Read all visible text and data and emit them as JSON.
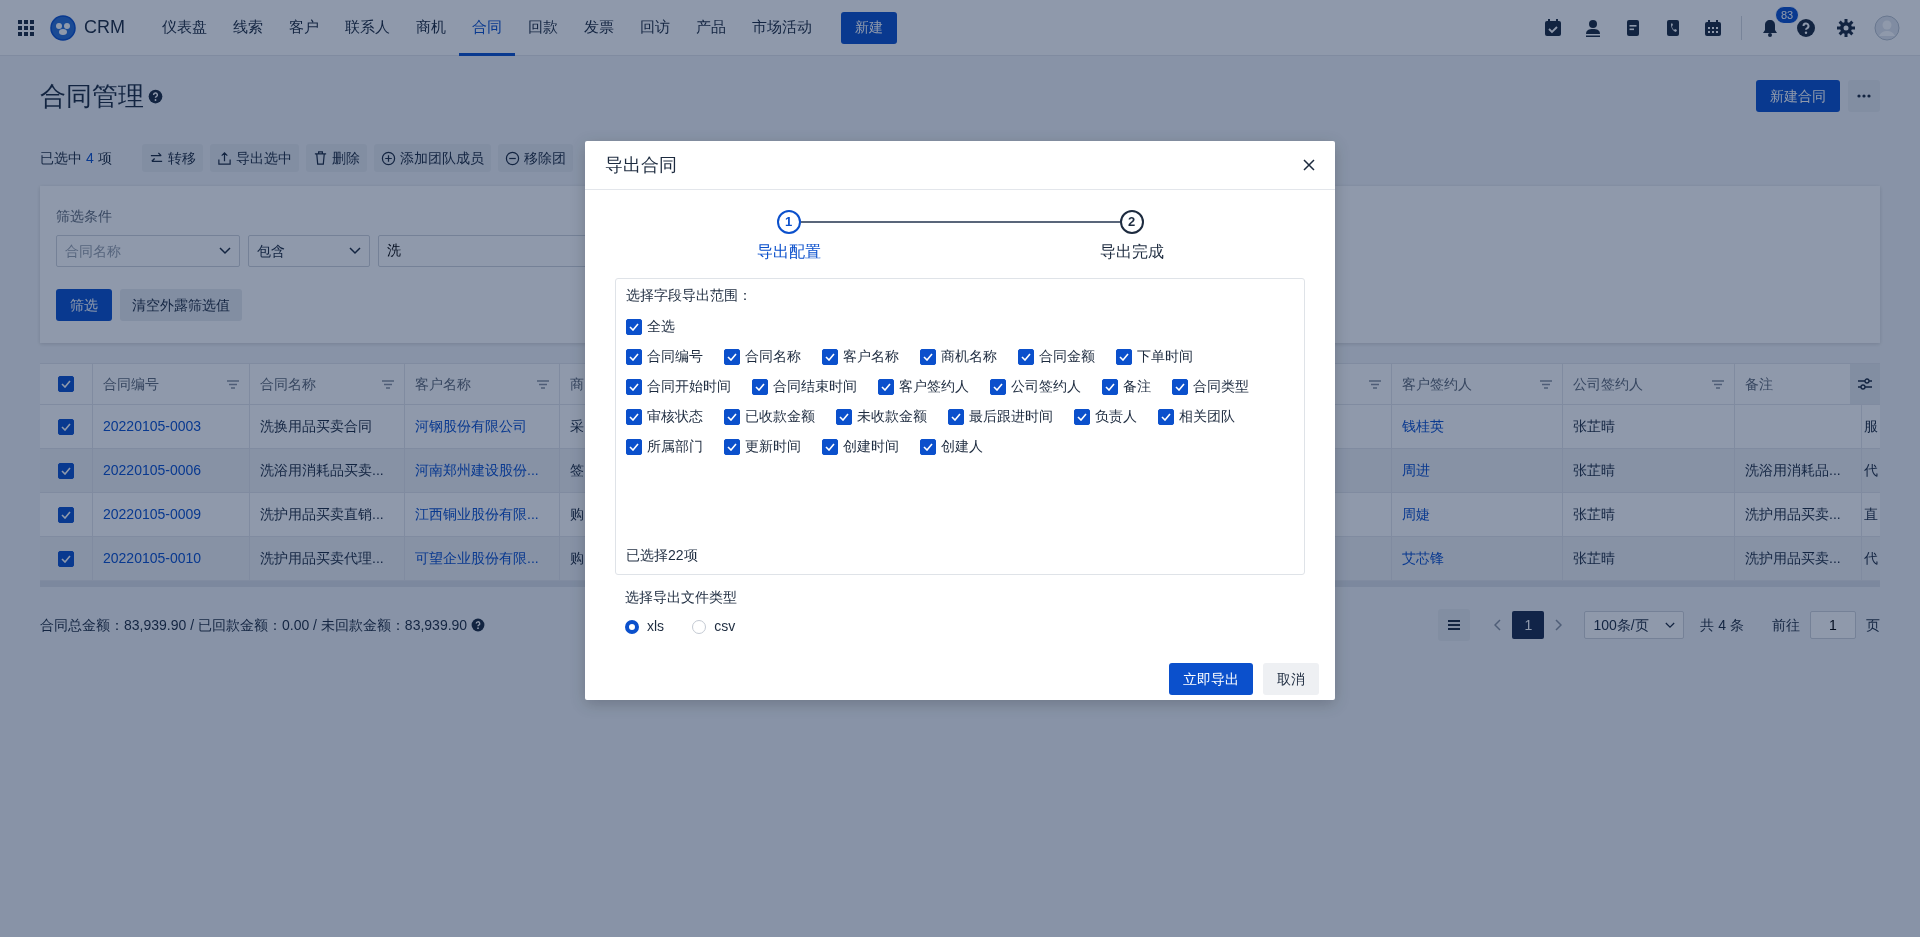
{
  "nav": {
    "brand": "CRM",
    "items": [
      {
        "label": "仪表盘",
        "selected": false
      },
      {
        "label": "线索",
        "selected": false
      },
      {
        "label": "客户",
        "selected": false
      },
      {
        "label": "联系人",
        "selected": false
      },
      {
        "label": "商机",
        "selected": false
      },
      {
        "label": "合同",
        "selected": true
      },
      {
        "label": "回款",
        "selected": false
      },
      {
        "label": "发票",
        "selected": false
      },
      {
        "label": "回访",
        "selected": false
      },
      {
        "label": "产品",
        "selected": false
      },
      {
        "label": "市场活动",
        "selected": false
      }
    ],
    "new_button": "新建",
    "notification_count": "83"
  },
  "page": {
    "title": "合同管理",
    "new_button": "新建合同"
  },
  "toolbar": {
    "selected_prefix": "已选中",
    "selected_count": "4",
    "selected_suffix": "项",
    "actions": [
      {
        "kind": "transfer",
        "label": "转移"
      },
      {
        "kind": "export",
        "label": "导出选中"
      },
      {
        "kind": "delete",
        "label": "删除"
      },
      {
        "kind": "add",
        "label": "添加团队成员"
      },
      {
        "kind": "remove",
        "label": "移除团"
      }
    ]
  },
  "filter": {
    "label": "筛选条件",
    "field": {
      "placeholder": "合同名称"
    },
    "operator": "包含",
    "value": "洗",
    "apply_button": "筛选",
    "clear_button": "清空外露筛选值"
  },
  "table": {
    "all_checked": true,
    "columns": [
      {
        "label": "合同编号",
        "kind": "link"
      },
      {
        "label": "合同名称",
        "kind": "text"
      },
      {
        "label": "客户名称",
        "kind": "link"
      },
      {
        "label": "商",
        "kind": "text"
      },
      {
        "label": "客户签约人",
        "kind": "link"
      },
      {
        "label": "公司签约人",
        "kind": "text"
      },
      {
        "label": "备注",
        "kind": "text"
      },
      {
        "kind": "text"
      }
    ],
    "rows": [
      {
        "selected": true,
        "cells": [
          "20220105-0003",
          "洗换用品买卖合同",
          "河钢股份有限公司",
          "采",
          "钱桂英",
          "张芷晴",
          null,
          "服"
        ]
      },
      {
        "selected": true,
        "cells": [
          "20220105-0006",
          "洗浴用消耗品买卖...",
          "河南郑州建设股份...",
          "签",
          "周进",
          "张芷晴",
          "洗浴用消耗品...",
          "代"
        ]
      },
      {
        "selected": true,
        "cells": [
          "20220105-0009",
          "洗护用品买卖直销...",
          "江西铜业股份有限...",
          "购",
          "周婕",
          "张芷晴",
          "洗护用品买卖...",
          "直"
        ]
      },
      {
        "selected": true,
        "cells": [
          "20220105-0010",
          "洗护用品买卖代理...",
          "可望企业股份有限...",
          "购",
          "艾芯锋",
          "张芷晴",
          "洗护用品买卖...",
          "代"
        ]
      }
    ]
  },
  "summary": "合同总金额：83,939.90 / 已回款金额：0.00 / 未回款金额：83,939.90",
  "pagination": {
    "pages": [
      {
        "label": "1",
        "selected": true
      }
    ],
    "page_size": "100条/页",
    "total": "共 4 条",
    "goto_label": "前往",
    "goto_value": "1",
    "goto_suffix": "页"
  },
  "dialog": {
    "title": "导出合同",
    "steps": [
      {
        "number": "1",
        "label": "导出配置",
        "selected": true
      },
      {
        "number": "2",
        "label": "导出完成",
        "selected": false
      }
    ],
    "fields_label": "选择字段导出范围：",
    "select_all": {
      "label": "全选",
      "checked": true
    },
    "fields": [
      {
        "label": "合同编号",
        "checked": true
      },
      {
        "label": "合同名称",
        "checked": true
      },
      {
        "label": "客户名称",
        "checked": true
      },
      {
        "label": "商机名称",
        "checked": true
      },
      {
        "label": "合同金额",
        "checked": true
      },
      {
        "label": "下单时间",
        "checked": true
      },
      {
        "label": "合同开始时间",
        "checked": true
      },
      {
        "label": "合同结束时间",
        "checked": true
      },
      {
        "label": "客户签约人",
        "checked": true
      },
      {
        "label": "公司签约人",
        "checked": true
      },
      {
        "label": "备注",
        "checked": true
      },
      {
        "label": "合同类型",
        "checked": true
      },
      {
        "label": "审核状态",
        "checked": true
      },
      {
        "label": "已收款金额",
        "checked": true
      },
      {
        "label": "未收款金额",
        "checked": true
      },
      {
        "label": "最后跟进时间",
        "checked": true
      },
      {
        "label": "负责人",
        "checked": true
      },
      {
        "label": "相关团队",
        "checked": true
      },
      {
        "label": "所属部门",
        "checked": true
      },
      {
        "label": "更新时间",
        "checked": true
      },
      {
        "label": "创建时间",
        "checked": true
      },
      {
        "label": "创建人",
        "checked": true
      }
    ],
    "selected_count": "已选择22项",
    "file_type_label": "选择导出文件类型",
    "file_types": [
      {
        "label": "xls",
        "selected": true
      },
      {
        "label": "csv",
        "selected": false
      }
    ],
    "buttons": [
      {
        "kind": "primary",
        "label": "立即导出"
      },
      {
        "kind": "secondary",
        "label": "取消"
      }
    ]
  }
}
